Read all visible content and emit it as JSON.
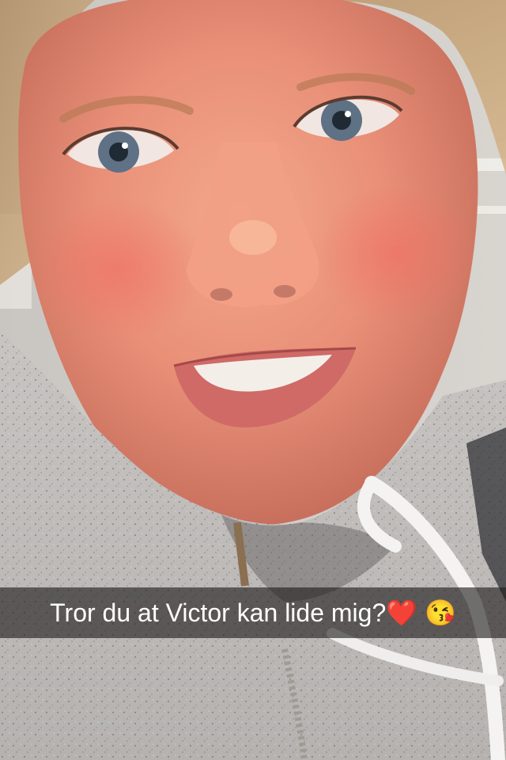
{
  "snap": {
    "caption": "Tror du at Victor kan lide mig?❤️ 😘"
  }
}
